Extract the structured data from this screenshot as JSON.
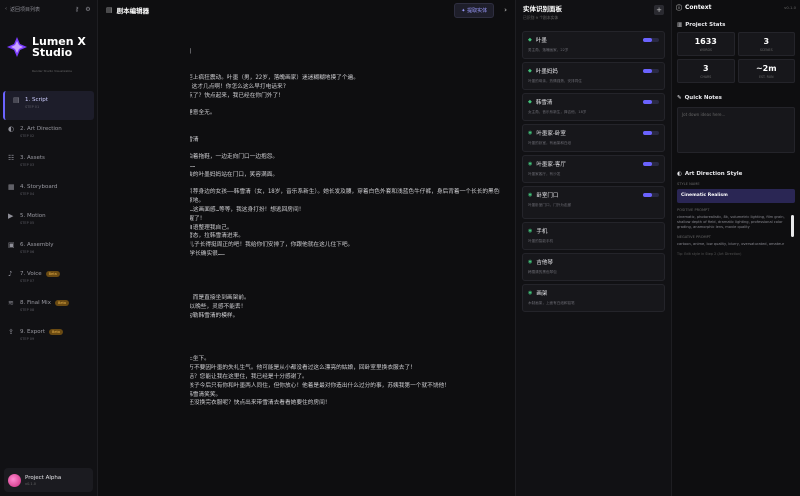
{
  "sidebar": {
    "back_label": "返回项目列表",
    "logo_line1": "Lumen X",
    "logo_line2": "Studio",
    "logo_sub": "Render Studio Visualizable",
    "steps": [
      {
        "label": "1. Script",
        "sub": "STEP 01",
        "icon": "script-icon",
        "active": true
      },
      {
        "label": "2. Art Direction",
        "sub": "STEP 02",
        "icon": "palette-icon"
      },
      {
        "label": "3. Assets",
        "sub": "STEP 03",
        "icon": "assets-icon"
      },
      {
        "label": "4. Storyboard",
        "sub": "STEP 04",
        "icon": "storyboard-icon"
      },
      {
        "label": "5. Motion",
        "sub": "STEP 05",
        "icon": "motion-icon"
      },
      {
        "label": "6. Assembly",
        "sub": "STEP 06",
        "icon": "assembly-icon"
      },
      {
        "label": "7. Voice",
        "sub": "STEP 07",
        "icon": "voice-icon",
        "badge": "Beta"
      },
      {
        "label": "8. Final Mix",
        "sub": "STEP 08",
        "icon": "mix-icon",
        "badge": "Beta"
      },
      {
        "label": "9. Export",
        "sub": "STEP 09",
        "icon": "export-icon",
        "badge": "Beta"
      }
    ],
    "project_name": "Project Alpha",
    "project_sub": "v0.1.0"
  },
  "editor": {
    "title": "剧本编辑器",
    "extract_label": "提取实体",
    "collapse_label": "›",
    "text": "第1集\n\n1-1 叶墨家-卧室［清晨］［内］\n人物:  叶墨\n\n△ 昏暗的卧室里，手机在床头柜上疯狂震动。叶墨（男，22岁，落魄画家）迷迷糊糊地摸了个遍。\n叶墨（睡梦/起床气）:   妈，这才几点啊！你怎么这么早打电话来?\n叶墨妈妈（V.O.）:  什么几点了？快点起来，我已经在你门外了！\n叶墨（惊醒）:   已经来了?\n△ 叶墨一个激灵从床上坐起，睡意全无。\n\n1-2 叶墨家-客厅［日］［内］\n人物:  叶墨, 叶墨妈妈, 韩雪清\n\n△ 叶墨穿着蓝白相间睡衣，跟拍着拖鞋，一边走向门口一边抱怨。\n叶墨:   怎么不事先打个招呼……\n△ 他打开房门，一身深蓝职业装的叶墨妈妈站在门口，笑容满面。\n叶墨妈妈:   惊喜！\n△ 叶墨妈妈两手向左，为叶墨引荐身边的女孩——韩雪清（女，18岁，音乐系新生）。她长发及腰，穿着白色外套和浅蓝色牛仔裤，身后背着一个长长的黑色琴包。\n△ 叶墨的目光被她吸引，愣在原地。\n叶墨（OS）:   弹吉他的女孩…这画面感…等等，我这身打扮！想逃回房间！\n叶墨（尴尬）:   我应门刚睡醒了！\n△ 叶墨赶紧要逃回房间，自言自语整理我自己。\n△ 叶墨妈妈满意地看着儿子的窘态，拉韩雪清进来。\n叶墨妈妈:   怎么样雪清？我儿子长得挺周正的吧！我给你们安排了，你跟他就在这儿住下吧。\n韩雪清（害羞）:   嗯……叶墨学长确实很……\n\n1-3 叶墨家-卧室［日］［内］\n人物:  叶墨\n\n△ 叶墨冲回卧室，没有换衣服，而是直接坐到画架前。\n叶墨（OS）:   不行，形象可以晚些，灵感不能丢！\n△ 他拿起铅笔，在白纸上迅速勾勒韩雪清的模样。\n\n1-4 叶墨家-客厅［日］［内］\n人物:  叶墨妈妈, 韩雪清\n\n△ 叶墨妈妈和韩雪清坐在沙发上坐下。\n叶墨妈妈:   雪清啊，你可千万不要因叶墨的失礼生气。他可能是从小都没看过这么漂亮的姑娘，回卧室里换衣服去了！\n韩雪清:   苏姨您这是说哪里话？您能让我在这里住，我已经是十分感谢了。\n叶墨妈妈（严肃）:   您管这孩子今后只有你和叶墨两人同住，但你放心！他着是最对你造出什么过分的事，苏姨我第一个就不饶他！\n△ 她悄悄儿子去房了，转头朝韩雪清笑笑。\n叶墨妈妈:   叶墨你嫌哪哪的还没换完衣服呢？快点出来带雪清去看看她要住的房间！"
  },
  "entities": {
    "title": "实体识别面板",
    "subtitle": "已识别 9 个剧本实体",
    "add_label": "+",
    "items": [
      {
        "name": "叶墨",
        "desc": "男主角，落魄画家，22岁",
        "toggle": true
      },
      {
        "name": "叶墨妈妈",
        "desc": "叶墨的母亲，热情强势，安排同住",
        "toggle": true
      },
      {
        "name": "韩雪清",
        "desc": "女主角，音乐系新生，弹吉他，18岁",
        "toggle": true
      },
      {
        "name": "叶墨家-卧室",
        "desc": "叶墨的卧室，有画架和白纸",
        "toggle": true,
        "loc": true
      },
      {
        "name": "叶墨家-客厅",
        "desc": "叶墨家客厅，有沙发",
        "toggle": true,
        "loc": true
      },
      {
        "name": "卧室门口",
        "desc": "叶墨卧室门口，门外为走廊",
        "toggle": true,
        "loc": true,
        "tall": true
      },
      {
        "name": "手机",
        "desc": "叶墨的智能手机",
        "toggle": false,
        "loc": true
      },
      {
        "name": "吉他琴",
        "desc": "韩雪清的黑色琴包",
        "toggle": false,
        "loc": true
      },
      {
        "name": "画架",
        "desc": "木制画架，上面有白纸和铅笔",
        "toggle": false,
        "loc": true
      }
    ]
  },
  "context": {
    "title": "Context",
    "version": "v0.1.0",
    "stats_title": "Project Stats",
    "stats": [
      {
        "value": "1633",
        "label": "WORDS"
      },
      {
        "value": "3",
        "label": "SCENES"
      },
      {
        "value": "3",
        "label": "CHARS"
      },
      {
        "value": "~2m",
        "label": "EST. RUN"
      }
    ],
    "notes_title": "Quick Notes",
    "notes_placeholder": "Jot down ideas here...",
    "art_title": "Art Direction Style",
    "style_label": "STYLE NAME",
    "style_name": "Cinematic Realism",
    "pos_label": "POSITIVE PROMPT",
    "pos_text": "cinematic, photorealistic, 8k, volumetric lighting, film grain, shallow depth of field, dramatic lighting, professional color grading, anamorphic lens, movie quality",
    "neg_label": "NEGATIVE PROMPT",
    "neg_text": "cartoon, anime, low quality, blurry, oversaturated, amateur",
    "hint": "Tip: Edit style in Step 2 (Art Direction)"
  }
}
